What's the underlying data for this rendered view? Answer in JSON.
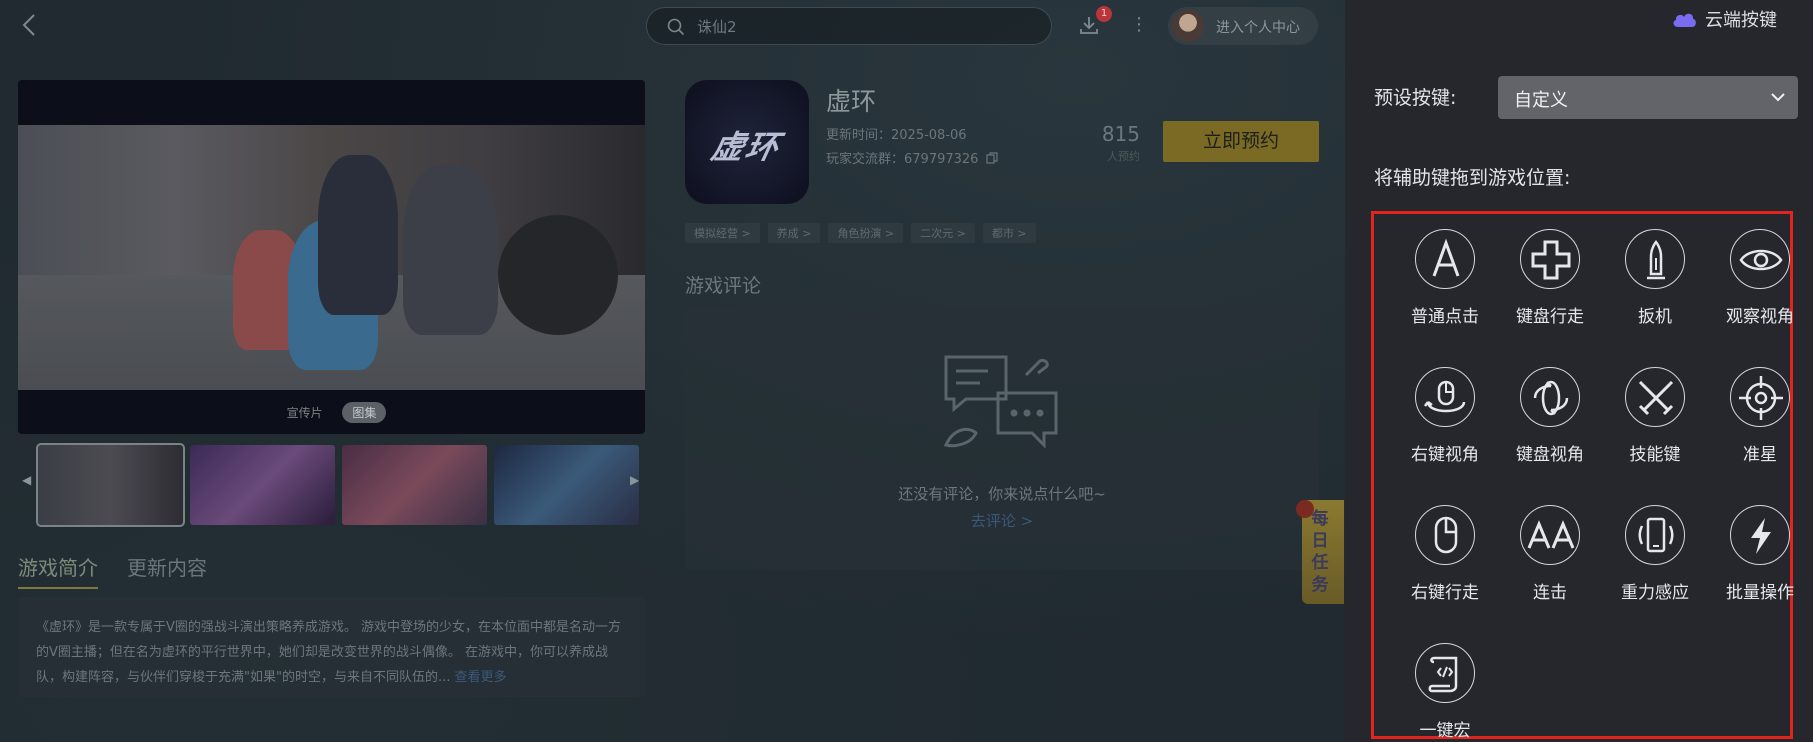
{
  "topbar": {
    "search_placeholder": "诛仙2",
    "download_badge": "1",
    "more_icon": "⋮",
    "user_center_label": "进入个人中心"
  },
  "media": {
    "tabs": [
      "宣传片",
      "图集"
    ],
    "active_tab": "图集"
  },
  "game": {
    "title": "虚环",
    "logo_text": "虚环",
    "update_time": "更新时间：2025-08-06",
    "player_group": "玩家交流群：679797326",
    "reserve_count": "815",
    "reserve_label": "人预约",
    "reserve_button": "立即预约",
    "tags": [
      "模拟经营 >",
      "养成 >",
      "角色扮演 >",
      "二次元 >",
      "都市 >"
    ]
  },
  "intro": {
    "tab_intro": "游戏简介",
    "tab_update": "更新内容",
    "text": "《虚环》是一款专属于V圈的强战斗演出策略养成游戏。 游戏中登场的少女，在本位面中都是名动一方的V圈主播；但在名为虚环的平行世界中，她们却是改变世界的战斗偶像。 在游戏中，你可以养成战队，构建阵容，与伙伴们穿梭于充满\"如果\"的时空，与来自不同队伍的...",
    "more": "查看更多"
  },
  "reviews": {
    "heading": "游戏评论",
    "empty_text": "还没有评论，你来说点什么吧~",
    "go_review": "去评论 >"
  },
  "daily_task": {
    "text": "每日任务"
  },
  "panel": {
    "cloud_label": "云端按键",
    "preset_label": "预设按键:",
    "preset_value": "自定义",
    "drag_label": "将辅助键拖到游戏位置:",
    "keys": [
      {
        "label": "普通点击",
        "icon": "letter-a-icon"
      },
      {
        "label": "键盘行走",
        "icon": "dpad-icon"
      },
      {
        "label": "扳机",
        "icon": "bullet-icon"
      },
      {
        "label": "观察视角",
        "icon": "eye-icon"
      },
      {
        "label": "右键视角",
        "icon": "mouse-rotate-icon"
      },
      {
        "label": "键盘视角",
        "icon": "rotate-icon"
      },
      {
        "label": "技能键",
        "icon": "crossed-swords-icon"
      },
      {
        "label": "准星",
        "icon": "crosshair-icon"
      },
      {
        "label": "右键行走",
        "icon": "mouse-icon"
      },
      {
        "label": "连击",
        "icon": "double-a-icon"
      },
      {
        "label": "重力感应",
        "icon": "phone-shake-icon"
      },
      {
        "label": "批量操作",
        "icon": "lightning-icon"
      },
      {
        "label": "一键宏",
        "icon": "script-icon"
      }
    ]
  }
}
